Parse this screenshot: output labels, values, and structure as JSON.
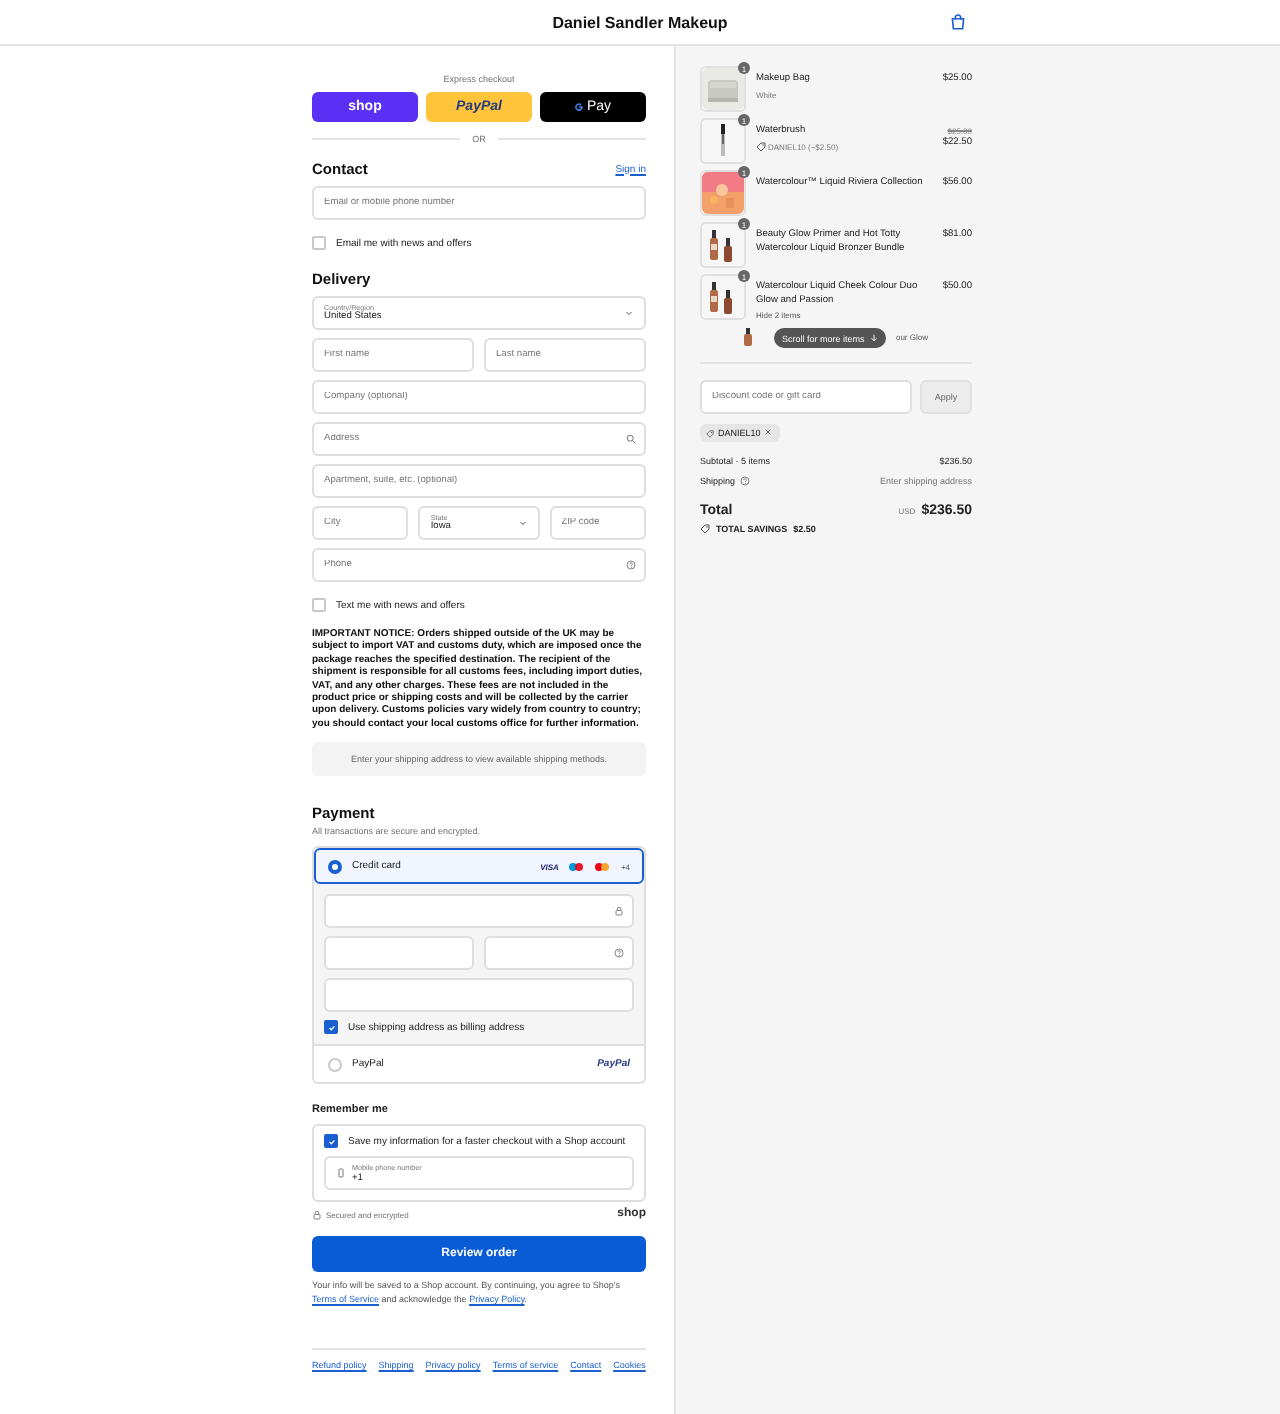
{
  "header": {
    "title": "Daniel Sandler Makeup"
  },
  "express": {
    "label": "Express checkout",
    "buttons": [
      {
        "kind": "shop",
        "label": "shop"
      },
      {
        "kind": "paypal",
        "label": "PayPal"
      },
      {
        "kind": "gpay",
        "label": "Pay"
      }
    ],
    "divider": "OR"
  },
  "contact": {
    "title": "Contact",
    "sign_in": "Sign in",
    "field": {
      "placeholder": "Email or mobile phone number"
    },
    "newsletter": {
      "label": "Email me with news and offers",
      "checked": false
    }
  },
  "delivery": {
    "title": "Delivery",
    "rows": [
      [
        {
          "kind": "select",
          "label": "Country/Region",
          "value": "United States"
        }
      ],
      [
        {
          "kind": "text",
          "placeholder": "First name"
        },
        {
          "kind": "text",
          "placeholder": "Last name"
        }
      ],
      [
        {
          "kind": "text",
          "placeholder": "Company (optional)"
        }
      ],
      [
        {
          "kind": "search",
          "placeholder": "Address"
        }
      ],
      [
        {
          "kind": "text",
          "placeholder": "Apartment, suite, etc. (optional)"
        }
      ],
      [
        {
          "kind": "text",
          "placeholder": "City"
        },
        {
          "kind": "select",
          "label": "State",
          "value": "Iowa"
        },
        {
          "kind": "text",
          "placeholder": "ZIP code"
        }
      ],
      [
        {
          "kind": "help",
          "placeholder": "Phone"
        }
      ]
    ],
    "sms": {
      "label": "Text me with news and offers",
      "checked": false
    },
    "notice": "IMPORTANT NOTICE: Orders shipped outside of the UK may be subject to import VAT and customs duty, which are imposed once the package reaches the specified destination. The recipient of the shipment is responsible for all customs fees, including import duties, VAT, and any other charges. These fees are not included in the product price or shipping costs and will be collected by the carrier upon delivery. Customs policies vary widely from country to country; you should contact your local customs office for further information.",
    "shipping_methods": "Enter your shipping address to view available shipping methods."
  },
  "payment": {
    "title": "Payment",
    "subtitle": "All transactions are secure and encrypted.",
    "methods": [
      {
        "kind": "card",
        "label": "Credit card",
        "selected": true,
        "brand": "VISA",
        "more": "+4"
      },
      {
        "kind": "paypal",
        "label": "PayPal",
        "selected": false,
        "brand": "PayPal"
      }
    ],
    "card_rows": [
      [
        {
          "kind": "lock"
        }
      ],
      [
        {
          "kind": "text"
        },
        {
          "kind": "help"
        }
      ],
      [
        {
          "kind": "text"
        }
      ]
    ],
    "billing": {
      "label": "Use shipping address as billing address",
      "checked": true
    }
  },
  "remember": {
    "title": "Remember me",
    "save": {
      "label": "Save my information for a faster checkout with a Shop account",
      "checked": true
    },
    "phone": {
      "label": "Mobile phone number",
      "value": "+1"
    },
    "secure": "Secured and encrypted",
    "brand": "shop"
  },
  "review_button": "Review order",
  "legal": {
    "before": "Your info will be saved to a Shop account. By continuing, you agree to Shop's ",
    "terms": "Terms of Service",
    "middle": " and acknowledge the ",
    "privacy": "Privacy Policy",
    "after": "."
  },
  "footer_links": [
    "Refund policy",
    "Shipping",
    "Privacy policy",
    "Terms of service",
    "Contact",
    "Cookies"
  ],
  "summary": {
    "items": [
      {
        "quantity": "1",
        "name": "Makeup Bag",
        "variant": "White",
        "price": "$25.00"
      },
      {
        "quantity": "1",
        "name": "Waterbrush",
        "discount": "DANIEL10 (−$2.50)",
        "compare_price": "$25.00",
        "price": "$22.50"
      },
      {
        "quantity": "1",
        "name": "Watercolour™ Liquid Riviera Collection",
        "price": "$56.00"
      },
      {
        "quantity": "1",
        "name": "Beauty Glow Primer and Hot Totty Watercolour Liquid Bronzer Bundle",
        "price": "$81.00"
      },
      {
        "quantity": "1",
        "name": "Watercolour Liquid Cheek Colour Duo Glow and Passion",
        "price": "$50.00",
        "toggle": "Hide 2 items",
        "sub_item": "our Glow"
      }
    ],
    "scroll_hint": "Scroll for more items",
    "discount": {
      "placeholder": "Discount code or gift card",
      "button": "Apply",
      "code": "DANIEL10"
    },
    "subtotal": {
      "label": "Subtotal · 5 items",
      "value": "$236.50"
    },
    "shipping": {
      "label": "Shipping",
      "value": "Enter shipping address"
    },
    "total": {
      "label": "Total",
      "currency": "USD",
      "value": "$236.50"
    },
    "savings": {
      "label": "TOTAL SAVINGS",
      "value": "$2.50"
    }
  }
}
